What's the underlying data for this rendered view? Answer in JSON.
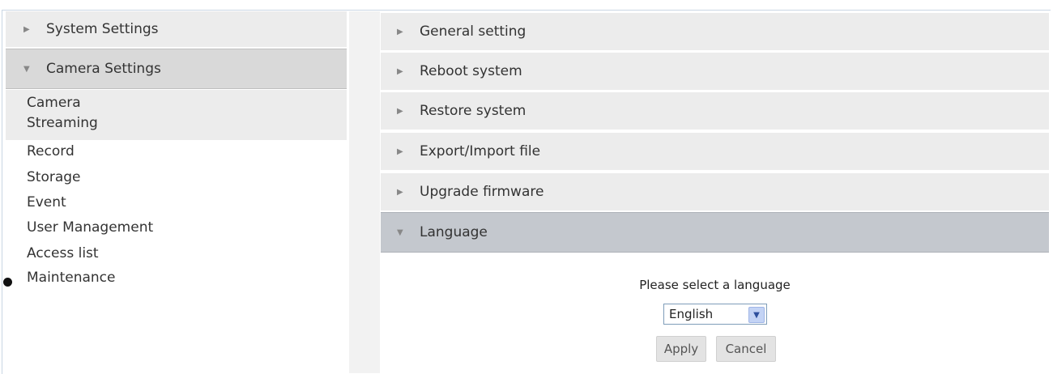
{
  "sidebar": {
    "system_settings": "System Settings",
    "camera_settings": "Camera Settings",
    "camera_items": [
      "Camera",
      "Streaming"
    ],
    "system_items": [
      "Record",
      "Storage",
      "Event",
      "User Management",
      "Access list",
      "Maintenance"
    ],
    "selected_item": "Maintenance"
  },
  "main": {
    "sections": [
      "General setting",
      "Reboot system",
      "Restore system",
      "Export/Import file",
      "Upgrade firmware",
      "Language"
    ],
    "expanded_section": "Language",
    "language": {
      "prompt": "Please select a language",
      "selected": "English",
      "apply_label": "Apply",
      "cancel_label": "Cancel"
    }
  },
  "icons": {
    "collapsed": "triangle-right-icon",
    "expanded": "triangle-down-icon",
    "selected_marker": "bullet-icon",
    "dropdown": "chevron-down-icon"
  }
}
